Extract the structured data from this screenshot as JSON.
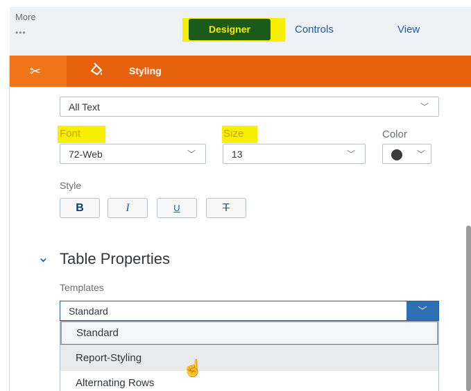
{
  "topbar": {
    "more_label": "More",
    "more_dots": "•••",
    "tabs": [
      {
        "label": "Designer",
        "active": true
      },
      {
        "label": "Controls"
      },
      {
        "label": "View"
      }
    ]
  },
  "panel": {
    "tools_icon": "scissors-tools-icon",
    "styling_icon": "paint-bucket-icon",
    "styling_label": "Styling",
    "accent": "#e8620d"
  },
  "text_target": {
    "value": "All Text"
  },
  "font": {
    "label": "Font",
    "value": "72-Web"
  },
  "size": {
    "label": "Size",
    "value": "13"
  },
  "color": {
    "label": "Color",
    "swatch": "#3b3b3b"
  },
  "style": {
    "label": "Style",
    "buttons": [
      "B",
      "I",
      "U",
      "T"
    ]
  },
  "table_properties": {
    "title": "Table Properties",
    "templates_label": "Templates",
    "templates_value": "Standard",
    "options": [
      "Standard",
      "Report-Styling",
      "Alternating Rows"
    ]
  },
  "highlight": "#f6f000"
}
